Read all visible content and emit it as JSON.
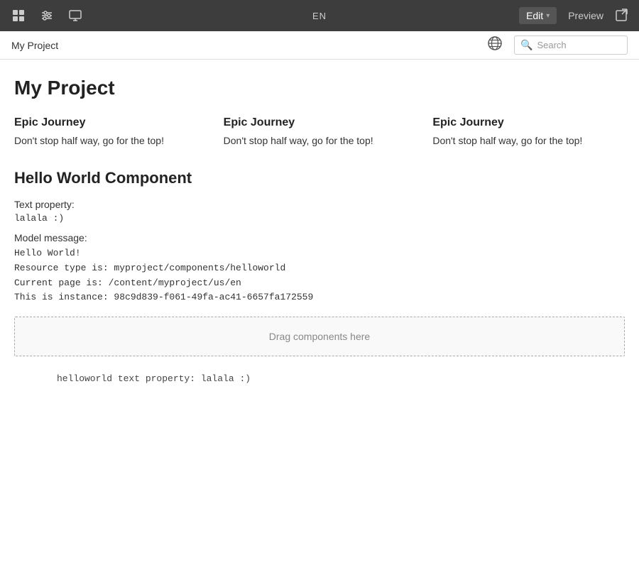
{
  "topNav": {
    "lang": "EN",
    "editLabel": "Edit",
    "previewLabel": "Preview",
    "icons": {
      "layout": "⊞",
      "sliders": "⊟",
      "monitor": "▣",
      "share": "⬡"
    }
  },
  "breadcrumb": {
    "text": "My Project"
  },
  "search": {
    "placeholder": "Search"
  },
  "main": {
    "pageTitle": "My Project",
    "epicColumns": [
      {
        "title": "Epic Journey",
        "body": "Don't stop half way, go for the top!"
      },
      {
        "title": "Epic Journey",
        "body": "Don't stop half way, go for the top!"
      },
      {
        "title": "Epic Journey",
        "body": "Don't stop half way, go for the top!"
      }
    ],
    "helloWorldSection": {
      "title": "Hello World Component",
      "textPropertyLabel": "Text property:",
      "textPropertyValue": "lalala :)",
      "modelMessageLabel": "Model message:",
      "modelMessageLines": [
        "Hello World!",
        "Resource type is: myproject/components/helloworld",
        "Current page is:  /content/myproject/us/en",
        "This is instance: 98c9d839-f061-49fa-ac41-6657fa172559"
      ]
    },
    "dragArea": "Drag components here",
    "footerMono": "helloworld text property: lalala :)"
  }
}
